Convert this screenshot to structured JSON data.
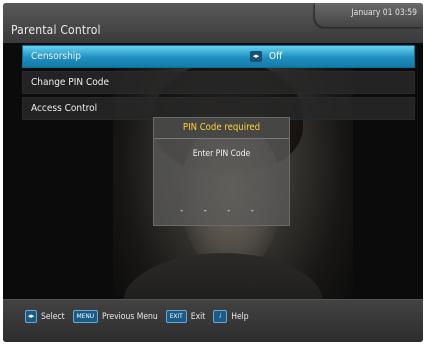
{
  "header": {
    "title": "Parental Control",
    "datetime": "January 01 03:59"
  },
  "menu": {
    "items": [
      {
        "label": "Censorship",
        "value": "Off",
        "selected": true
      },
      {
        "label": "Change PIN Code"
      },
      {
        "label": "Access Control"
      }
    ],
    "value_arrows_glyph": "◂▸"
  },
  "dialog": {
    "title": "PIN Code required",
    "message": "Enter PIN Code",
    "pin_placeholder": "- - - -"
  },
  "footer": {
    "select_key": "◂▸",
    "select_label": "Select",
    "menu_key": "MENU",
    "menu_label": "Previous Menu",
    "exit_key": "EXIT",
    "exit_label": "Exit",
    "help_key": "i",
    "help_label": "Help"
  },
  "colors": {
    "highlight": "#1f8fbf",
    "dialog_title": "#ffd23a",
    "key_background": "#1b5a86"
  }
}
